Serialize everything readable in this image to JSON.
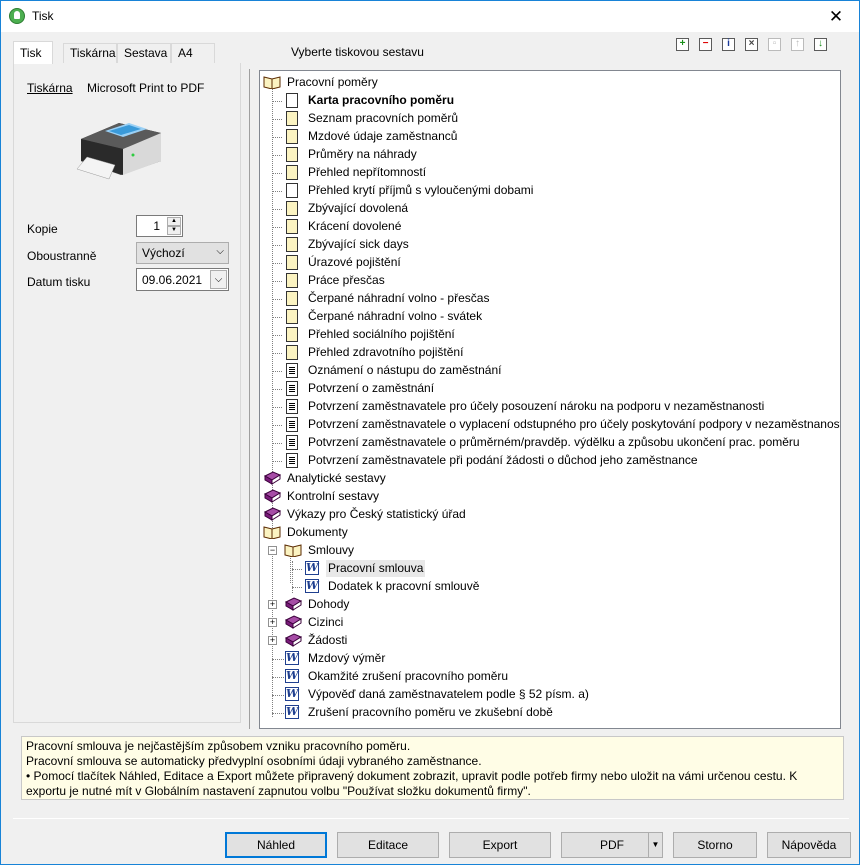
{
  "window": {
    "title": "Tisk",
    "close": "✕"
  },
  "tabs": [
    "Tisk",
    "Tiskárna",
    "Sestava",
    "A4"
  ],
  "header": {
    "label": "Vyberte tiskovou sestavu"
  },
  "printer": {
    "label": "Tiskárna",
    "name": "Microsoft Print to PDF"
  },
  "form": {
    "copies_label": "Kopie",
    "copies_value": "1",
    "duplex_label": "Oboustranně",
    "duplex_value": "Výchozí",
    "date_label": "Datum tisku",
    "date_value": "09.06.2021"
  },
  "tree": {
    "pracovni": "Pracovní poměry",
    "p_items": [
      "Karta pracovního poměru",
      "Seznam pracovních poměrů",
      "Mzdové údaje zaměstnanců",
      "Průměry na náhrady",
      "Přehled nepřítomností",
      "Přehled krytí příjmů s vyloučenými dobami",
      "Zbývající dovolená",
      "Krácení dovolené",
      "Zbývající sick days",
      "Úrazové pojištění",
      "Práce přesčas",
      "Čerpané náhradní volno - přesčas",
      "Čerpané náhradní volno - svátek",
      "Přehled sociálního pojištění",
      "Přehled zdravotního pojištění",
      "Oznámení o nástupu do zaměstnání",
      "Potvrzení o zaměstnání",
      "Potvrzení zaměstnavatele pro účely posouzení nároku na podporu v nezaměstnanosti",
      "Potvrzení zaměstnavatele o vyplacení odstupného pro účely poskytování podpory v nezaměstnanosti",
      "Potvrzení zaměstnavatele o průměrném/pravděp. výdělku a způsobu ukončení prac. poměru",
      "Potvrzení zaměstnavatele při podání žádosti o důchod jeho zaměstnance"
    ],
    "analyticke": "Analytické sestavy",
    "kontrolni": "Kontrolní sestavy",
    "vykazy": "Výkazy pro Český statistický úřad",
    "dokumenty": "Dokumenty",
    "smlouvy": "Smlouvy",
    "s_items": [
      "Pracovní smlouva",
      "Dodatek k pracovní smlouvě"
    ],
    "dohody": "Dohody",
    "cizinci": "Cizinci",
    "zadosti": "Žádosti",
    "d_items": [
      "Mzdový výměr",
      "Okamžité zrušení pracovního poměru",
      "Výpověď daná zaměstnavatelem podle § 52 písm. a)",
      "Zrušení pracovního poměru ve zkušební době"
    ]
  },
  "info": {
    "line1": "Pracovní smlouva je nejčastějším způsobem vzniku pracovního poměru.",
    "line2": "Pracovní smlouva se automaticky předvyplní osobními údaji vybraného zaměstnance.",
    "line3": "• Pomocí tlačítek Náhled, Editace a Export můžete připravený dokument zobrazit, upravit podle potřeb firmy nebo uložit na vámi určenou cestu. K exportu je nutné mít v Globálním nastavení zapnutou volbu \"Používat složku dokumentů firmy\"."
  },
  "buttons": {
    "nahled": "Náhled",
    "editace": "Editace",
    "export": "Export",
    "pdf": "PDF",
    "storno": "Storno",
    "napoveda": "Nápověda"
  }
}
